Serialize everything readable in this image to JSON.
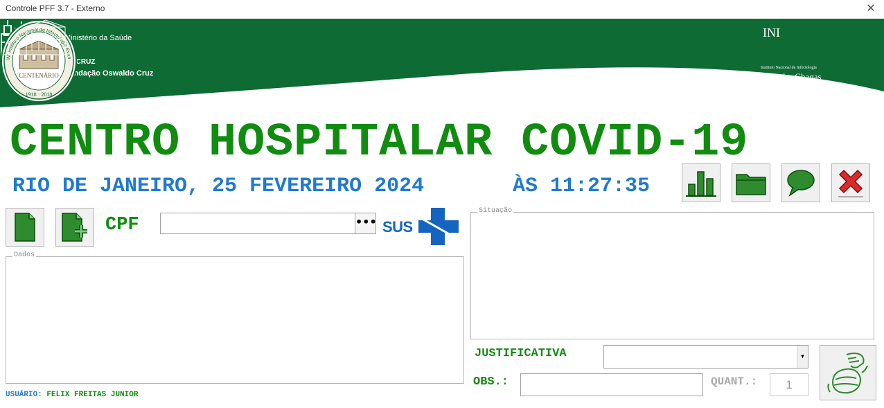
{
  "window": {
    "title": "Controle PFF 3.7 - Externo",
    "close_label": "✕"
  },
  "banner": {
    "ministry": "Ministério da Saúde",
    "fiocruz": "FIOCRUZ",
    "fundacao": "Fundação Oswaldo Cruz",
    "seal_ring": "INI Instituto Nacional de Infectologia Evandro Chagas Fiocruz",
    "seal_centenario": "CENTENÁRIO",
    "seal_years": "1918 · 2018",
    "ini_abbr": "INI",
    "ini_small": "Instituto Nacional de Infectologia",
    "ini_name": "Evandro Chagas"
  },
  "header": {
    "main_title": "CENTRO HOSPITALAR COVID-19",
    "date_text": "RIO DE JANEIRO, 25 FEVEREIRO 2024",
    "time_text": "ÀS 11:27:35"
  },
  "toolbar": {
    "buttons": [
      {
        "icon": "bar-chart-icon"
      },
      {
        "icon": "folder-icon"
      },
      {
        "icon": "speech-bubble-icon"
      },
      {
        "icon": "red-x-icon"
      }
    ]
  },
  "cpf": {
    "label": "CPF",
    "value": "",
    "browse_label": "•••",
    "sus_text": "SUS"
  },
  "groups": {
    "dados": "Dados",
    "situacao": "Situação"
  },
  "footer": {
    "usuario_label": "USUÁRIO:",
    "usuario_name": "FELIX FREITAS JUNIOR"
  },
  "form": {
    "justificativa_label": "JUSTIFICATIVA",
    "justificativa_value": "",
    "obs_label": "OBS.:",
    "obs_value": "",
    "quant_label": "QUANT.:",
    "quant_value": "1"
  },
  "colors": {
    "banner_green": "#0e6b34",
    "title_green": "#118c11",
    "date_blue": "#1f7ad0",
    "sus_blue": "#1565c0"
  }
}
